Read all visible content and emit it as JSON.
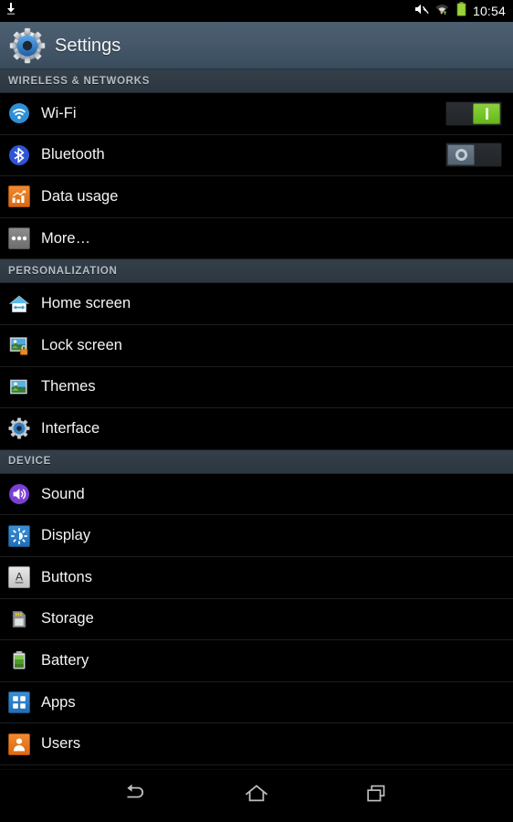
{
  "statusbar": {
    "left_icons": [
      {
        "name": "download-icon"
      }
    ],
    "right_icons": [
      {
        "name": "volume-mute-icon"
      },
      {
        "name": "wifi-data-icon"
      },
      {
        "name": "battery-icon"
      }
    ],
    "clock": "10:54"
  },
  "actionbar": {
    "title": "Settings",
    "icon": "settings-gear-icon"
  },
  "sections": [
    {
      "header": "WIRELESS & NETWORKS",
      "items": [
        {
          "label": "Wi-Fi",
          "icon": "wifi-icon",
          "control": "switch",
          "state": "on"
        },
        {
          "label": "Bluetooth",
          "icon": "bluetooth-icon",
          "control": "switch",
          "state": "off"
        },
        {
          "label": "Data usage",
          "icon": "data-usage-icon",
          "control": "none"
        },
        {
          "label": "More…",
          "icon": "more-icon",
          "control": "none"
        }
      ]
    },
    {
      "header": "PERSONALIZATION",
      "items": [
        {
          "label": "Home screen",
          "icon": "home-screen-icon",
          "control": "none"
        },
        {
          "label": "Lock screen",
          "icon": "lock-screen-icon",
          "control": "none"
        },
        {
          "label": "Themes",
          "icon": "themes-icon",
          "control": "none"
        },
        {
          "label": "Interface",
          "icon": "interface-gear-icon",
          "control": "none"
        }
      ]
    },
    {
      "header": "DEVICE",
      "items": [
        {
          "label": "Sound",
          "icon": "sound-icon",
          "control": "none"
        },
        {
          "label": "Display",
          "icon": "display-icon",
          "control": "none"
        },
        {
          "label": "Buttons",
          "icon": "buttons-icon",
          "control": "none"
        },
        {
          "label": "Storage",
          "icon": "storage-icon",
          "control": "none"
        },
        {
          "label": "Battery",
          "icon": "battery-settings-icon",
          "control": "none"
        },
        {
          "label": "Apps",
          "icon": "apps-icon",
          "control": "none"
        },
        {
          "label": "Users",
          "icon": "users-icon",
          "control": "none"
        }
      ]
    }
  ],
  "navbar": {
    "buttons": [
      {
        "name": "back-button",
        "icon": "back-arrow-icon"
      },
      {
        "name": "home-button",
        "icon": "home-icon"
      },
      {
        "name": "recents-button",
        "icon": "recents-icon"
      }
    ]
  },
  "colors": {
    "accent_blue": "#3b8fd4",
    "switch_on_green": "#76c528",
    "switch_off_gray": "#5d6d7b",
    "actionbar_top": "#4c6071",
    "actionbar_bottom": "#394b5b",
    "section_header_bg": "#2f3943",
    "list_bg": "#000000",
    "row_text": "#f4f4f4",
    "section_text": "#b5bcc2",
    "orange": "#e87722",
    "purple": "#7a3fd4"
  }
}
